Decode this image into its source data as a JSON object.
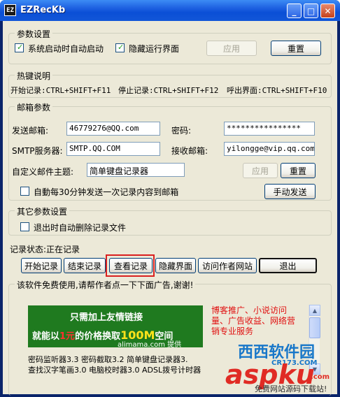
{
  "window": {
    "title": "EZRecKb",
    "icon_text": "EZ",
    "min_glyph": "_",
    "max_glyph": "□",
    "close_glyph": "✕"
  },
  "params": {
    "title": "参数设置",
    "autostart_label": "系统启动时自动启动",
    "hide_ui_label": "隐藏运行界面",
    "apply_label": "应用",
    "reset_label": "重置"
  },
  "hotkeys": {
    "title": "热键说明",
    "start": "开始记录:CTRL+SHIFT+F11",
    "stop": "停止记录:CTRL+SHIFT+F12",
    "show": "呼出界面:CTRL+SHIFT+F10"
  },
  "mail": {
    "title": "邮箱参数",
    "sender_label": "发送邮箱:",
    "sender_value": "46779276@QQ.com",
    "password_label": "密码:",
    "password_value": "****************",
    "smtp_label": "SMTP服务器:",
    "smtp_value": "SMTP.QQ.COM",
    "receiver_label": "接收邮箱:",
    "receiver_value": "yilongge@vip.qq.com",
    "subject_label": "自定义邮件主题:",
    "subject_value": "简单键盘记录器",
    "apply_label": "应用",
    "reset_label": "重置",
    "auto_send_label": "自動每30分钟发送一次记录内容到邮箱",
    "manual_send_label": "手动发送"
  },
  "other": {
    "title": "其它参数设置",
    "auto_delete_label": "退出时自动删除记录文件"
  },
  "status": {
    "label": "记录状态:正在记录"
  },
  "actions": {
    "start": "开始记录",
    "stop": "结束记录",
    "view": "查看记录",
    "hide": "隐藏界面",
    "visit": "访问作者网站",
    "exit": "退出"
  },
  "ad": {
    "title": "该软件免费使用,请帮作者点一下下面广告,谢谢!",
    "banner_line1": "只需加上友情链接",
    "banner_line2_a": "就能以",
    "banner_line2_b": "1元",
    "banner_line2_c": "的价格换取",
    "banner_line2_d": "100M",
    "banner_line2_e": "空间",
    "banner_brand": "alimama.com 提供",
    "right_text": "博客推广、小说访问量、广告收益、网络营销专业服务",
    "list_line1": "密码监听器3.3 密码截取3.2 简单键盘记录器3.",
    "list_line2": "查找汉字笔画3.0 电脑校时器3.0 ADSL拨号计时器"
  },
  "watermark": {
    "brand": "西西软件园",
    "brand_url": "CR173.COM",
    "asp": "aspku",
    "asp_sub": ".com",
    "sub_text": "免费网站源码下载站!"
  },
  "colors": {
    "title_bar": "#0a4fd6",
    "highlight": "#d92020",
    "ad_green": "#1f7a1f"
  }
}
